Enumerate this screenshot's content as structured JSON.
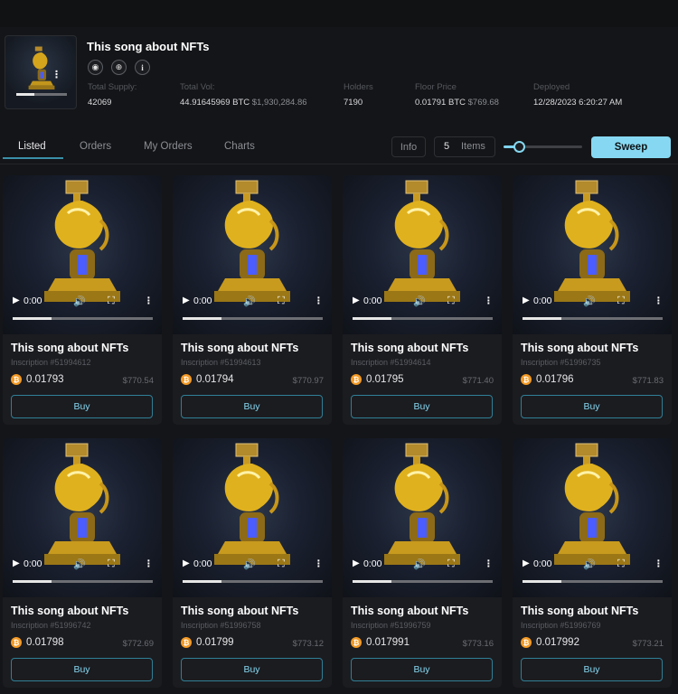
{
  "collection": {
    "title": "This song about NFTs",
    "social": [
      {
        "name": "discord-icon",
        "glyph": "◉"
      },
      {
        "name": "globe-icon",
        "glyph": "⊕"
      },
      {
        "name": "info-icon",
        "glyph": "i"
      }
    ],
    "stats": [
      {
        "label": "Total Supply:",
        "value": "42069",
        "sub": ""
      },
      {
        "label": "Total Vol:",
        "value": "44.91645969 BTC",
        "sub": "$1,930,284.86"
      },
      {
        "label": "Holders",
        "value": "7190",
        "sub": ""
      },
      {
        "label": "Floor Price",
        "value": "0.01791 BTC",
        "sub": "$769.68"
      },
      {
        "label": "Deployed",
        "value": "12/28/2023 6:20:27 AM",
        "sub": ""
      }
    ]
  },
  "tabs": [
    {
      "label": "Listed",
      "active": true
    },
    {
      "label": "Orders",
      "active": false
    },
    {
      "label": "My Orders",
      "active": false
    },
    {
      "label": "Charts",
      "active": false
    }
  ],
  "controls": {
    "info_label": "Info",
    "items_count": "5",
    "items_label": "Items",
    "sweep_label": "Sweep",
    "slider_fraction": 0.2
  },
  "player": {
    "time": "0:00",
    "play_icon": "▶",
    "volume_icon": "🔊",
    "fullscreen_icon": "⛶",
    "more_icon": "⋮",
    "progress_fraction": 0.28
  },
  "btc_symbol": "₿",
  "listings": [
    {
      "title": "This song about NFTs",
      "inscription": "Inscription #51994612",
      "price": "0.01793",
      "usd": "$770.54",
      "buy_label": "Buy"
    },
    {
      "title": "This song about NFTs",
      "inscription": "Inscription #51994613",
      "price": "0.01794",
      "usd": "$770.97",
      "buy_label": "Buy"
    },
    {
      "title": "This song about NFTs",
      "inscription": "Inscription #51994614",
      "price": "0.01795",
      "usd": "$771.40",
      "buy_label": "Buy"
    },
    {
      "title": "This song about NFTs",
      "inscription": "Inscription #51996735",
      "price": "0.01796",
      "usd": "$771.83",
      "buy_label": "Buy"
    },
    {
      "title": "This song about NFTs",
      "inscription": "Inscription #51996742",
      "price": "0.01798",
      "usd": "$772.69",
      "buy_label": "Buy"
    },
    {
      "title": "This song about NFTs",
      "inscription": "Inscription #51996758",
      "price": "0.01799",
      "usd": "$773.12",
      "buy_label": "Buy"
    },
    {
      "title": "This song about NFTs",
      "inscription": "Inscription #51996759",
      "price": "0.017991",
      "usd": "$773.16",
      "buy_label": "Buy"
    },
    {
      "title": "This song about NFTs",
      "inscription": "Inscription #51996769",
      "price": "0.017992",
      "usd": "$773.21",
      "buy_label": "Buy"
    }
  ],
  "colors": {
    "background": "#141518",
    "card": "#1b1c20",
    "accent": "#86d8f2",
    "btc": "#f59a23"
  }
}
